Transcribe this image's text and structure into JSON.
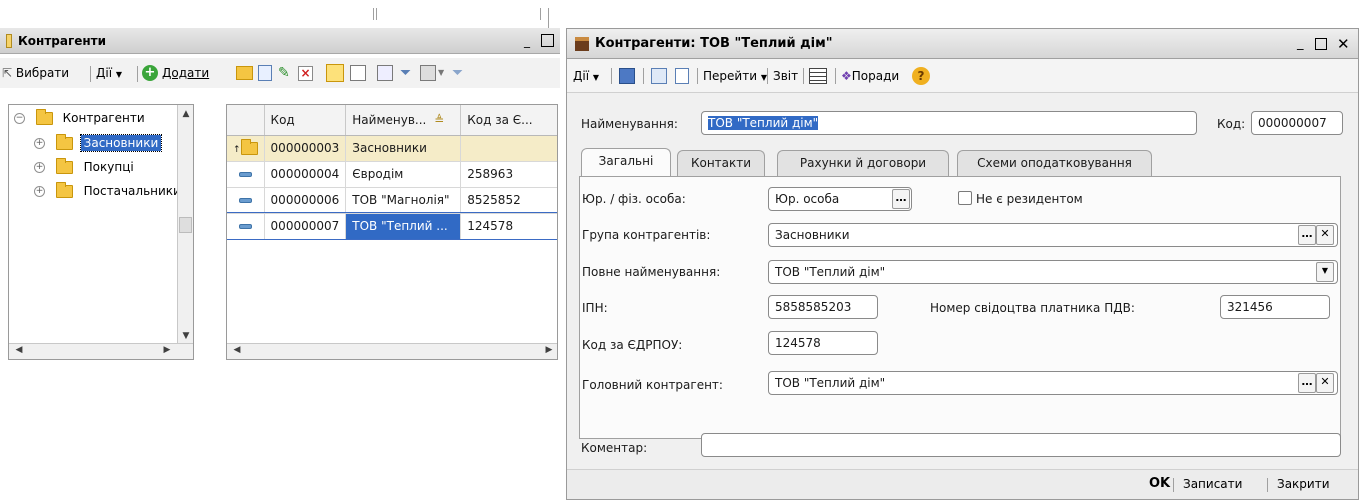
{
  "left_window": {
    "title": "Контрагенти",
    "toolbar": {
      "select_label": "Вибрати",
      "actions_label": "Дії",
      "add_label": "Додати"
    },
    "tree": {
      "root": "Контрагенти",
      "items": [
        "Засновники",
        "Покупці",
        "Постачальники"
      ],
      "selected": "Засновники"
    },
    "grid": {
      "columns": [
        "Код",
        "Найменув...",
        "Код за Є..."
      ],
      "rows": [
        {
          "code": "000000003",
          "name": "Засновники",
          "edrpou": "",
          "type": "folder"
        },
        {
          "code": "000000004",
          "name": "Євродім",
          "edrpou": "258963",
          "type": "item"
        },
        {
          "code": "000000006",
          "name": "ТОВ \"Магнолія\"",
          "edrpou": "8525852",
          "type": "item"
        },
        {
          "code": "000000007",
          "name": "ТОВ \"Теплий ...",
          "edrpou": "124578",
          "type": "item"
        }
      ]
    }
  },
  "form_window": {
    "title": "Контрагенти: ТОВ \"Теплий дім\"",
    "toolbar": {
      "actions_label": "Дії",
      "goto_label": "Перейти",
      "report_label": "Звіт",
      "tips_label": "Поради"
    },
    "name_label": "Найменування:",
    "name_value": "ТОВ \"Теплий дім\"",
    "code_label": "Код:",
    "code_value": "000000007",
    "tabs": [
      "Загальні",
      "Контакти",
      "Рахунки й договори",
      "Схеми оподатковування"
    ],
    "fields": {
      "entity_type_label": "Юр. / фіз. особа:",
      "entity_type_value": "Юр. особа",
      "non_resident_label": "Не є резидентом",
      "group_label": "Група контрагентів:",
      "group_value": "Засновники",
      "full_name_label": "Повне найменування:",
      "full_name_value": "ТОВ \"Теплий дім\"",
      "ipn_label": "ІПН:",
      "ipn_value": "5858585203",
      "vat_cert_label": "Номер свідоцтва платника ПДВ:",
      "vat_cert_value": "321456",
      "edrpou_label": "Код за ЄДРПОУ:",
      "edrpou_value": "124578",
      "parent_label": "Головний контрагент:",
      "parent_value": "ТОВ \"Теплий дім\""
    },
    "comment_label": "Коментар:",
    "comment_value": "",
    "buttons": {
      "ok": "OK",
      "save": "Записати",
      "close": "Закрити"
    }
  }
}
